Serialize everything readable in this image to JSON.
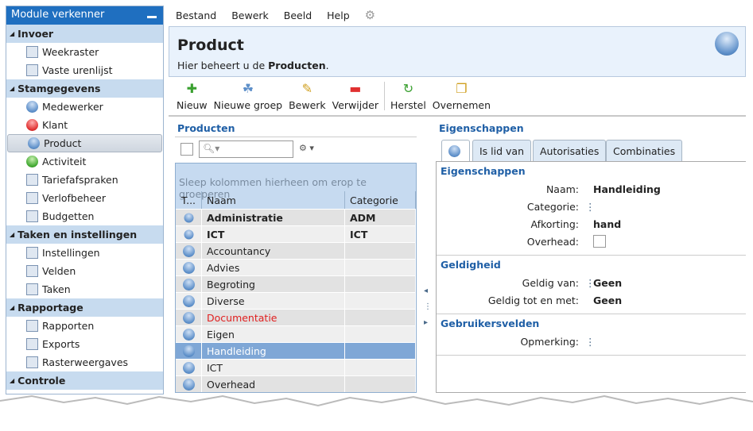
{
  "sidebar": {
    "title": "Module verkenner",
    "sections": [
      {
        "label": "Invoer",
        "items": [
          {
            "label": "Weekraster",
            "icon": "calendar-grid-icon"
          },
          {
            "label": "Vaste urenlijst",
            "icon": "table-icon"
          }
        ]
      },
      {
        "label": "Stamgegevens",
        "items": [
          {
            "label": "Medewerker",
            "icon": "person-icon"
          },
          {
            "label": "Klant",
            "icon": "red-ball-icon"
          },
          {
            "label": "Product",
            "icon": "blue-ball-icon",
            "selected": true
          },
          {
            "label": "Activiteit",
            "icon": "green-ball-icon"
          },
          {
            "label": "Tariefafspraken",
            "icon": "rate-clock-icon"
          },
          {
            "label": "Verlofbeheer",
            "icon": "calendar-icon"
          },
          {
            "label": "Budgetten",
            "icon": "money-bag-icon"
          }
        ]
      },
      {
        "label": "Taken en instellingen",
        "items": [
          {
            "label": "Instellingen",
            "icon": "gear-icon"
          },
          {
            "label": "Velden",
            "icon": "fields-icon"
          },
          {
            "label": "Taken",
            "icon": "tools-icon"
          }
        ]
      },
      {
        "label": "Rapportage",
        "items": [
          {
            "label": "Rapporten",
            "icon": "report-icon"
          },
          {
            "label": "Exports",
            "icon": "database-icon"
          },
          {
            "label": "Rasterweergaves",
            "icon": "grid-icon"
          }
        ]
      },
      {
        "label": "Controle",
        "items": []
      }
    ]
  },
  "menu": [
    "Bestand",
    "Bewerk",
    "Beeld",
    "Help"
  ],
  "header": {
    "title": "Product",
    "subtitle_prefix": "Hier beheert u de ",
    "subtitle_bold": "Producten",
    "subtitle_suffix": "."
  },
  "toolbar": [
    {
      "label": "Nieuw",
      "icon": "plus-icon",
      "glyph": "✚",
      "color": "#3aa030"
    },
    {
      "label": "Nieuwe groep",
      "icon": "new-group-icon",
      "glyph": "☘",
      "color": "#5d8fc9"
    },
    {
      "label": "Bewerk",
      "icon": "pencil-icon",
      "glyph": "✎",
      "color": "#d0a020"
    },
    {
      "label": "Verwijder",
      "icon": "delete-icon",
      "glyph": "▬",
      "color": "#e03030"
    },
    {
      "label": "Herstel",
      "icon": "restore-icon",
      "glyph": "↻",
      "color": "#3aa030"
    },
    {
      "label": "Overnemen",
      "icon": "copy-icon",
      "glyph": "❐",
      "color": "#d0a020"
    }
  ],
  "products": {
    "title": "Producten",
    "group_hint": "Sleep kolommen hierheen om erop te groeperen",
    "columns": [
      "T...",
      "Naam",
      "Categorie"
    ],
    "rows": [
      {
        "type": "group",
        "name": "Administratie",
        "cat": "ADM",
        "bold": true
      },
      {
        "type": "group",
        "name": "ICT",
        "cat": "ICT",
        "bold": true
      },
      {
        "type": "product",
        "name": "Accountancy",
        "cat": ""
      },
      {
        "type": "product",
        "name": "Advies",
        "cat": ""
      },
      {
        "type": "product",
        "name": "Begroting",
        "cat": ""
      },
      {
        "type": "product",
        "name": "Diverse",
        "cat": ""
      },
      {
        "type": "product",
        "name": "Documentatie",
        "cat": "",
        "color": "#e02020"
      },
      {
        "type": "product",
        "name": "Eigen",
        "cat": ""
      },
      {
        "type": "product",
        "name": "Handleiding",
        "cat": "",
        "selected": true
      },
      {
        "type": "product",
        "name": "ICT",
        "cat": ""
      },
      {
        "type": "product",
        "name": "Overhead",
        "cat": ""
      }
    ]
  },
  "properties": {
    "title": "Eigenschappen",
    "tabs": [
      "Is lid van",
      "Autorisaties",
      "Combinaties"
    ],
    "sections": [
      {
        "title": "Eigenschappen",
        "rows": [
          {
            "label": "Naam:",
            "value": "Handleiding"
          },
          {
            "label": "Categorie:",
            "value": ""
          },
          {
            "label": "Afkorting:",
            "value": "hand"
          },
          {
            "label": "Overhead:",
            "checkbox": false
          }
        ]
      },
      {
        "title": "Geldigheid",
        "rows": [
          {
            "label": "Geldig van:",
            "value": "Geen"
          },
          {
            "label": "Geldig tot en met:",
            "value": "Geen"
          }
        ]
      },
      {
        "title": "Gebruikersvelden",
        "rows": [
          {
            "label": "Opmerking:",
            "value": ""
          }
        ]
      }
    ]
  }
}
